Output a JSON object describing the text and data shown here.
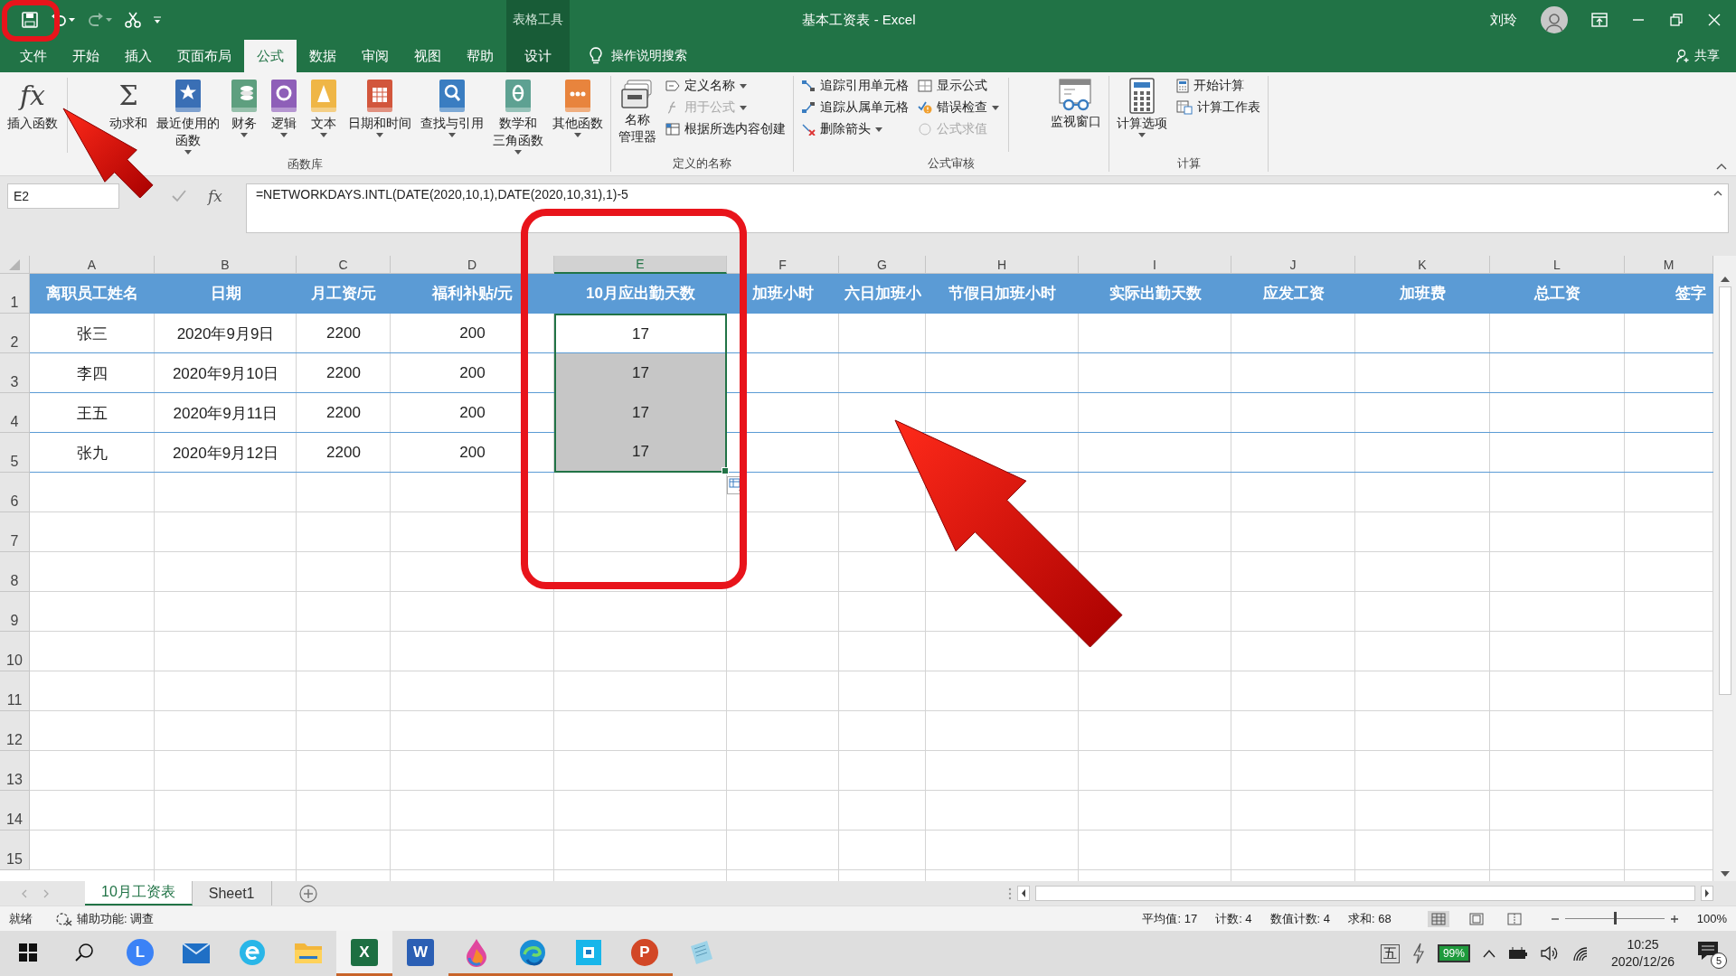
{
  "title_bar": {
    "redo_disabled": true,
    "context_label": "表格工具",
    "title": "基本工资表 - Excel",
    "user": "刘玲"
  },
  "ribbon_tabs": [
    {
      "label": "文件",
      "selected": false,
      "kind": "normal"
    },
    {
      "label": "开始",
      "selected": false,
      "kind": "normal"
    },
    {
      "label": "插入",
      "selected": false,
      "kind": "normal"
    },
    {
      "label": "页面布局",
      "selected": false,
      "kind": "normal"
    },
    {
      "label": "公式",
      "selected": true,
      "kind": "normal"
    },
    {
      "label": "数据",
      "selected": false,
      "kind": "normal"
    },
    {
      "label": "审阅",
      "selected": false,
      "kind": "normal"
    },
    {
      "label": "视图",
      "selected": false,
      "kind": "normal"
    },
    {
      "label": "帮助",
      "selected": false,
      "kind": "normal"
    },
    {
      "label": "设计",
      "selected": false,
      "kind": "context"
    }
  ],
  "tell_me": "操作说明搜索",
  "share": "共享",
  "ribbon_groups": [
    {
      "label": "函数库",
      "items": [
        {
          "kind": "large",
          "label": "插入函数",
          "icon_text": "fx",
          "dropdown": false,
          "divider_after": true
        },
        {
          "kind": "large",
          "label": "动求和",
          "icon_text": "Σ",
          "dropdown": false
        },
        {
          "kind": "large",
          "label_lines": [
            "最近使用的",
            "函数"
          ],
          "dropdown": true
        },
        {
          "kind": "large",
          "label": "财务",
          "dropdown": true
        },
        {
          "kind": "large",
          "label": "逻辑",
          "dropdown": true
        },
        {
          "kind": "large",
          "label": "文本",
          "dropdown": true
        },
        {
          "kind": "large",
          "label": "日期和时间",
          "dropdown": true
        },
        {
          "kind": "large",
          "label": "查找与引用",
          "dropdown": true
        },
        {
          "kind": "large",
          "label_lines": [
            "数学和",
            "三角函数"
          ],
          "dropdown": true
        },
        {
          "kind": "large",
          "label": "其他函数",
          "dropdown": true
        }
      ]
    },
    {
      "label": "定义的名称",
      "items": [
        {
          "kind": "large",
          "label_lines": [
            "名称",
            "管理器"
          ],
          "dropdown": false
        },
        {
          "kind": "stack",
          "items": [
            {
              "label": "定义名称",
              "dropdown": true,
              "disabled": false
            },
            {
              "label": "用于公式",
              "dropdown": true,
              "disabled": true
            },
            {
              "label": "根据所选内容创建",
              "dropdown": false,
              "disabled": false
            }
          ]
        }
      ]
    },
    {
      "label": "公式审核",
      "items": [
        {
          "kind": "stack",
          "items": [
            {
              "label": "追踪引用单元格",
              "dropdown": false,
              "disabled": false
            },
            {
              "label": "追踪从属单元格",
              "dropdown": false,
              "disabled": false
            },
            {
              "label": "删除箭头",
              "dropdown": true,
              "disabled": false
            }
          ]
        },
        {
          "kind": "stack",
          "items": [
            {
              "label": "显示公式",
              "dropdown": false,
              "disabled": false
            },
            {
              "label": "错误检查",
              "dropdown": true,
              "disabled": false
            },
            {
              "label": "公式求值",
              "dropdown": false,
              "disabled": true
            }
          ],
          "divider_after": true
        },
        {
          "kind": "large",
          "label": "监视窗口",
          "dropdown": false
        }
      ]
    },
    {
      "label": "计算",
      "items": [
        {
          "kind": "large",
          "label": "计算选项",
          "dropdown": true
        },
        {
          "kind": "stack",
          "items": [
            {
              "label": "开始计算",
              "dropdown": false,
              "disabled": false
            },
            {
              "label": "计算工作表",
              "dropdown": false,
              "disabled": false
            }
          ]
        }
      ]
    }
  ],
  "formula_bar": {
    "name_box": "E2",
    "fx_label": "fx",
    "formula": "=NETWORKDAYS.INTL(DATE(2020,10,1),DATE(2020,10,31),1)-5"
  },
  "columns": [
    {
      "label": "A",
      "selected": false
    },
    {
      "label": "B",
      "selected": false
    },
    {
      "label": "C",
      "selected": false
    },
    {
      "label": "D",
      "selected": false
    },
    {
      "label": "E",
      "selected": true
    },
    {
      "label": "F",
      "selected": false
    },
    {
      "label": "G",
      "selected": false
    },
    {
      "label": "H",
      "selected": false
    },
    {
      "label": "I",
      "selected": false
    },
    {
      "label": "J",
      "selected": false
    },
    {
      "label": "K",
      "selected": false
    },
    {
      "label": "L",
      "selected": false
    },
    {
      "label": "M",
      "selected": false
    }
  ],
  "header_row": {
    "number": "1",
    "cells": [
      "离职员工姓名",
      "日期",
      "月工资/元",
      "福利补贴/元",
      "10月应出勤天数",
      "加班小时",
      "六日加班小",
      "节假日加班小时",
      "实际出勤天数",
      "应发工资",
      "加班费",
      "总工资",
      "签字"
    ]
  },
  "rows": [
    {
      "number": "2",
      "cells": [
        "张三",
        "2020年9月9日",
        "2200",
        "200",
        "17"
      ],
      "active": true,
      "selected": false
    },
    {
      "number": "3",
      "cells": [
        "李四",
        "2020年9月10日",
        "2200",
        "200",
        "17"
      ],
      "active": false,
      "selected": true
    },
    {
      "number": "4",
      "cells": [
        "王五",
        "2020年9月11日",
        "2200",
        "200",
        "17"
      ],
      "active": false,
      "selected": true
    },
    {
      "number": "5",
      "cells": [
        "张九",
        "2020年9月12日",
        "2200",
        "200",
        "17"
      ],
      "active": false,
      "selected": true
    }
  ],
  "empty_row_numbers": [
    "6",
    "7",
    "8",
    "9",
    "10",
    "11",
    "12",
    "13",
    "14",
    "15"
  ],
  "sheet_tabs": [
    {
      "label": "10月工资表",
      "selected": true
    },
    {
      "label": "Sheet1",
      "selected": false
    }
  ],
  "status_bar": {
    "ready": "就绪",
    "accessibility": "辅助功能: 调查",
    "stats": [
      "平均值: 17",
      "计数: 4",
      "数值计数: 4",
      "求和: 68"
    ],
    "views": [
      {
        "selected": true
      },
      {
        "selected": false
      },
      {
        "selected": false
      }
    ],
    "zoom_slider": {
      "level": 0.5
    },
    "zoom": "100%"
  },
  "taskbar": {
    "apps": [
      {
        "kind": "badge",
        "icon_text": "L",
        "color": "#3b82f6",
        "running": false,
        "active": false
      },
      {
        "kind": "mail",
        "running": false,
        "active": false
      },
      {
        "kind": "ring",
        "running": false,
        "active": false
      },
      {
        "kind": "folder",
        "running": false,
        "active": false
      },
      {
        "kind": "tile",
        "icon_text": "X",
        "color": "#1d6f42",
        "running": true,
        "active": true
      },
      {
        "kind": "tile",
        "icon_text": "W",
        "color": "#2b5fb4",
        "running": false,
        "active": false
      },
      {
        "kind": "drop",
        "running": true,
        "active": false
      },
      {
        "kind": "swirl",
        "running": true,
        "active": false
      },
      {
        "kind": "square",
        "running": true,
        "active": false
      },
      {
        "kind": "badge",
        "icon_text": "P",
        "color": "#d24726",
        "running": true,
        "active": false
      },
      {
        "kind": "notepad",
        "running": false,
        "active": false
      }
    ],
    "ime": "五",
    "battery": "99%",
    "time": "10:25",
    "date": "2020/12/26",
    "notifications": "5"
  },
  "annotations": [
    {
      "kind": "ring"
    },
    {
      "kind": "frame"
    },
    {
      "kind": "arrow"
    },
    {
      "kind": "arrow"
    }
  ]
}
